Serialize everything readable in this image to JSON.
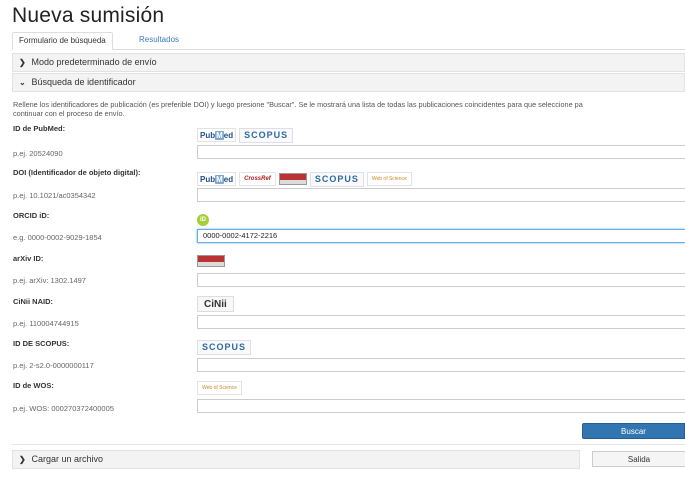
{
  "page_title": "Nueva sumisión",
  "tabs": [
    {
      "label": "Formulario de búsqueda"
    },
    {
      "label": "Resultados"
    }
  ],
  "sections": {
    "default_mode": "Modo predeterminado de envío",
    "identifier_search": "Búsqueda de identificador",
    "upload_file": "Cargar un archivo"
  },
  "description_line1": "Rellene los identificadores de publicación (es preferible DOI) y luego presione \"Buscar\". Se le mostrará una lista de todas las publicaciones coincidentes para que seleccione pa",
  "description_line2": "continuar con el proceso de envío.",
  "logo_text": {
    "pubmed_pub": "Pub",
    "pubmed_m": "M",
    "pubmed_ed": "ed",
    "scopus": "SCOPUS",
    "crossref": "CrossRef",
    "wos": "Web of Science",
    "orcid": "iD",
    "cinii": "CiNii"
  },
  "fields": [
    {
      "label": "ID de PubMed:",
      "hint": "p.ej. 20524090",
      "value": "",
      "sources": [
        "pubmed-logo",
        "scopus-logo"
      ]
    },
    {
      "label": "DOI (Identificador de objeto digital):",
      "hint": "p.ej. 10.1021/ac0354342",
      "value": "",
      "sources": [
        "pubmed-logo",
        "crossref-logo",
        "arxiv-logo",
        "scopus-logo",
        "wos-logo"
      ]
    },
    {
      "label": "ORCID iD:",
      "hint": "e.g. 0000-0002-9029-1854",
      "value": "0000-0002-4172-2216",
      "sources": [
        "orcid-logo"
      ]
    },
    {
      "label": "arXiv ID:",
      "hint": "p.ej. arXiv: 1302.1497",
      "value": "",
      "sources": [
        "arxiv-logo"
      ]
    },
    {
      "label": "CiNii NAID:",
      "hint": "p.ej. 110004744915",
      "value": "",
      "sources": [
        "cinii-logo"
      ]
    },
    {
      "label": "ID DE SCOPUS:",
      "hint": "p.ej. 2-s2.0-0000000117",
      "value": "",
      "sources": [
        "scopus-logo"
      ]
    },
    {
      "label": "ID de WOS:",
      "hint": "p.ej. WOS: 000270372400005",
      "value": "",
      "sources": [
        "wos-logo"
      ]
    }
  ],
  "buttons": {
    "search": "Buscar",
    "exit": "Salida"
  },
  "colors": {
    "primary": "#3276b1",
    "tab_link": "#3a7bbf",
    "orcid": "#a6ce39"
  }
}
